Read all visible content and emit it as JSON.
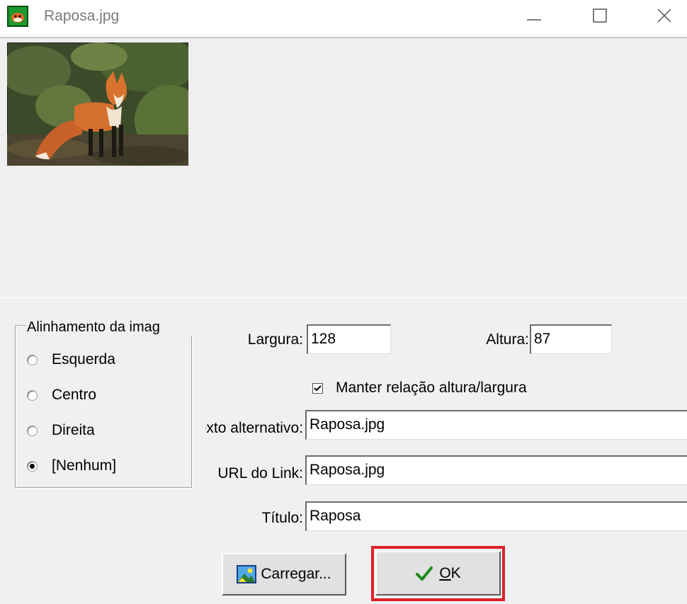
{
  "window": {
    "title": "Raposa.jpg",
    "icons": {
      "app": "fox-app-icon",
      "minimize": "minimize-icon",
      "maximize": "maximize-icon",
      "close": "close-icon"
    }
  },
  "preview": {
    "image_alt": "fox photo thumbnail"
  },
  "alignment": {
    "group_title": "Alinhamento da imag",
    "options": [
      {
        "label": "Esquerda",
        "checked": false
      },
      {
        "label": "Centro",
        "checked": false
      },
      {
        "label": "Direita",
        "checked": false
      },
      {
        "label": "[Nenhum]",
        "checked": true
      }
    ]
  },
  "fields": {
    "width_label": "Largura:",
    "width_value": "128",
    "height_label": "Altura:",
    "height_value": "87",
    "keep_ratio_label": "Manter relação altura/largura",
    "keep_ratio_checked": true,
    "alt_text_label": "Texto alternativo:",
    "alt_text_value": "Raposa.jpg",
    "link_url_label": "URL do Link:",
    "link_url_value": "Raposa.jpg",
    "title_label": "Título:",
    "title_value": "Raposa"
  },
  "buttons": {
    "load_label": "Carregar...",
    "ok_label_underlined": "O",
    "ok_label_rest": "K",
    "load_icon": "image-icon",
    "ok_icon": "checkmark-icon"
  },
  "colors": {
    "highlight": "#e0202a",
    "check_green": "#1a8a1a"
  }
}
